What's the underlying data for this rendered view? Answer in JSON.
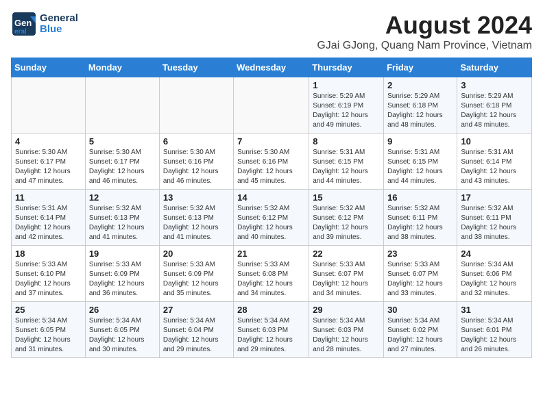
{
  "header": {
    "logo_line1": "General",
    "logo_line2": "Blue",
    "title": "August 2024",
    "subtitle": "GJai GJong, Quang Nam Province, Vietnam"
  },
  "weekdays": [
    "Sunday",
    "Monday",
    "Tuesday",
    "Wednesday",
    "Thursday",
    "Friday",
    "Saturday"
  ],
  "weeks": [
    [
      {
        "day": "",
        "info": ""
      },
      {
        "day": "",
        "info": ""
      },
      {
        "day": "",
        "info": ""
      },
      {
        "day": "",
        "info": ""
      },
      {
        "day": "1",
        "info": "Sunrise: 5:29 AM\nSunset: 6:19 PM\nDaylight: 12 hours\nand 49 minutes."
      },
      {
        "day": "2",
        "info": "Sunrise: 5:29 AM\nSunset: 6:18 PM\nDaylight: 12 hours\nand 48 minutes."
      },
      {
        "day": "3",
        "info": "Sunrise: 5:29 AM\nSunset: 6:18 PM\nDaylight: 12 hours\nand 48 minutes."
      }
    ],
    [
      {
        "day": "4",
        "info": "Sunrise: 5:30 AM\nSunset: 6:17 PM\nDaylight: 12 hours\nand 47 minutes."
      },
      {
        "day": "5",
        "info": "Sunrise: 5:30 AM\nSunset: 6:17 PM\nDaylight: 12 hours\nand 46 minutes."
      },
      {
        "day": "6",
        "info": "Sunrise: 5:30 AM\nSunset: 6:16 PM\nDaylight: 12 hours\nand 46 minutes."
      },
      {
        "day": "7",
        "info": "Sunrise: 5:30 AM\nSunset: 6:16 PM\nDaylight: 12 hours\nand 45 minutes."
      },
      {
        "day": "8",
        "info": "Sunrise: 5:31 AM\nSunset: 6:15 PM\nDaylight: 12 hours\nand 44 minutes."
      },
      {
        "day": "9",
        "info": "Sunrise: 5:31 AM\nSunset: 6:15 PM\nDaylight: 12 hours\nand 44 minutes."
      },
      {
        "day": "10",
        "info": "Sunrise: 5:31 AM\nSunset: 6:14 PM\nDaylight: 12 hours\nand 43 minutes."
      }
    ],
    [
      {
        "day": "11",
        "info": "Sunrise: 5:31 AM\nSunset: 6:14 PM\nDaylight: 12 hours\nand 42 minutes."
      },
      {
        "day": "12",
        "info": "Sunrise: 5:32 AM\nSunset: 6:13 PM\nDaylight: 12 hours\nand 41 minutes."
      },
      {
        "day": "13",
        "info": "Sunrise: 5:32 AM\nSunset: 6:13 PM\nDaylight: 12 hours\nand 41 minutes."
      },
      {
        "day": "14",
        "info": "Sunrise: 5:32 AM\nSunset: 6:12 PM\nDaylight: 12 hours\nand 40 minutes."
      },
      {
        "day": "15",
        "info": "Sunrise: 5:32 AM\nSunset: 6:12 PM\nDaylight: 12 hours\nand 39 minutes."
      },
      {
        "day": "16",
        "info": "Sunrise: 5:32 AM\nSunset: 6:11 PM\nDaylight: 12 hours\nand 38 minutes."
      },
      {
        "day": "17",
        "info": "Sunrise: 5:32 AM\nSunset: 6:11 PM\nDaylight: 12 hours\nand 38 minutes."
      }
    ],
    [
      {
        "day": "18",
        "info": "Sunrise: 5:33 AM\nSunset: 6:10 PM\nDaylight: 12 hours\nand 37 minutes."
      },
      {
        "day": "19",
        "info": "Sunrise: 5:33 AM\nSunset: 6:09 PM\nDaylight: 12 hours\nand 36 minutes."
      },
      {
        "day": "20",
        "info": "Sunrise: 5:33 AM\nSunset: 6:09 PM\nDaylight: 12 hours\nand 35 minutes."
      },
      {
        "day": "21",
        "info": "Sunrise: 5:33 AM\nSunset: 6:08 PM\nDaylight: 12 hours\nand 34 minutes."
      },
      {
        "day": "22",
        "info": "Sunrise: 5:33 AM\nSunset: 6:07 PM\nDaylight: 12 hours\nand 34 minutes."
      },
      {
        "day": "23",
        "info": "Sunrise: 5:33 AM\nSunset: 6:07 PM\nDaylight: 12 hours\nand 33 minutes."
      },
      {
        "day": "24",
        "info": "Sunrise: 5:34 AM\nSunset: 6:06 PM\nDaylight: 12 hours\nand 32 minutes."
      }
    ],
    [
      {
        "day": "25",
        "info": "Sunrise: 5:34 AM\nSunset: 6:05 PM\nDaylight: 12 hours\nand 31 minutes."
      },
      {
        "day": "26",
        "info": "Sunrise: 5:34 AM\nSunset: 6:05 PM\nDaylight: 12 hours\nand 30 minutes."
      },
      {
        "day": "27",
        "info": "Sunrise: 5:34 AM\nSunset: 6:04 PM\nDaylight: 12 hours\nand 29 minutes."
      },
      {
        "day": "28",
        "info": "Sunrise: 5:34 AM\nSunset: 6:03 PM\nDaylight: 12 hours\nand 29 minutes."
      },
      {
        "day": "29",
        "info": "Sunrise: 5:34 AM\nSunset: 6:03 PM\nDaylight: 12 hours\nand 28 minutes."
      },
      {
        "day": "30",
        "info": "Sunrise: 5:34 AM\nSunset: 6:02 PM\nDaylight: 12 hours\nand 27 minutes."
      },
      {
        "day": "31",
        "info": "Sunrise: 5:34 AM\nSunset: 6:01 PM\nDaylight: 12 hours\nand 26 minutes."
      }
    ]
  ]
}
